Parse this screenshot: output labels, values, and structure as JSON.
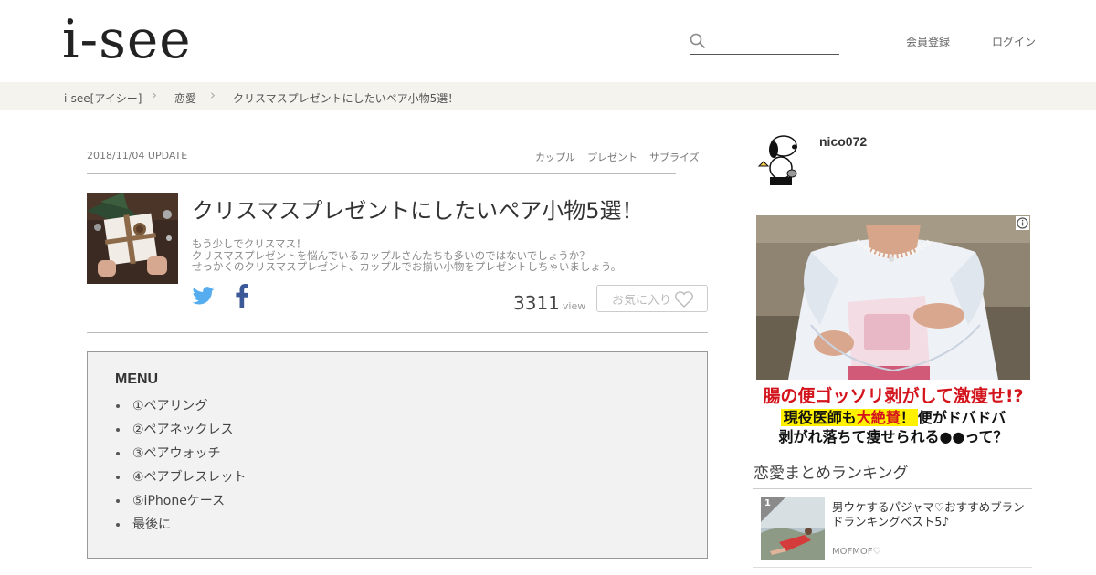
{
  "header": {
    "logo": "i-see",
    "search_placeholder": "",
    "register_label": "会員登録",
    "login_label": "ログイン"
  },
  "breadcrumb": [
    "i-see[アイシー]",
    "恋愛",
    "クリスマスプレゼントにしたいペア小物5選！"
  ],
  "article": {
    "date": "2018/11/04 UPDATE",
    "tags": [
      "カップル",
      "プレゼント",
      "サプライズ"
    ],
    "title": "クリスマスプレゼントにしたいペア小物5選！",
    "lead": [
      "もう少しでクリスマス！",
      "クリスマスプレゼントを悩んでいるカップルさんたちも多いのではないでしょうか？",
      "せっかくのクリスマスプレゼント、カップルでお揃い小物をプレゼントしちゃいましょう。"
    ],
    "views": "3311",
    "views_label": "view",
    "favorite_label": "お気に入り"
  },
  "menu": {
    "title": "MENU",
    "items": [
      "①ペアリング",
      "②ペアネックレス",
      "③ペアウォッチ",
      "④ペアブレスレット",
      "⑤iPhoneケース",
      "最後に"
    ]
  },
  "sidebar": {
    "author_name": "nico072",
    "ad": {
      "line1": "腸の便ゴッソリ剥がして激痩せ!?",
      "line2_hl_a": "現役医師も",
      "line2_hl_red": "大絶賛",
      "line2_hl_b": "！",
      "line2_rest": "便がドバドバ",
      "line3": "剥がれ落ちて痩せられる●●って？"
    },
    "ranking_title": "恋愛まとめランキング",
    "ranking": [
      {
        "rank": "1",
        "title": "男ウケするパジャマ♡おすすめブランドランキングベスト5♪",
        "author": "MOFMOF♡"
      }
    ]
  },
  "icons": {
    "search": "search-icon",
    "twitter": "twitter-icon",
    "facebook": "facebook-icon",
    "heart": "heart-icon",
    "info": "info-icon"
  },
  "colors": {
    "breadcrumb_bg": "#f5f3ee",
    "twitter": "#55acee",
    "facebook": "#3b5998",
    "ad_red": "#d4141c",
    "ad_yellow": "#fff100"
  }
}
